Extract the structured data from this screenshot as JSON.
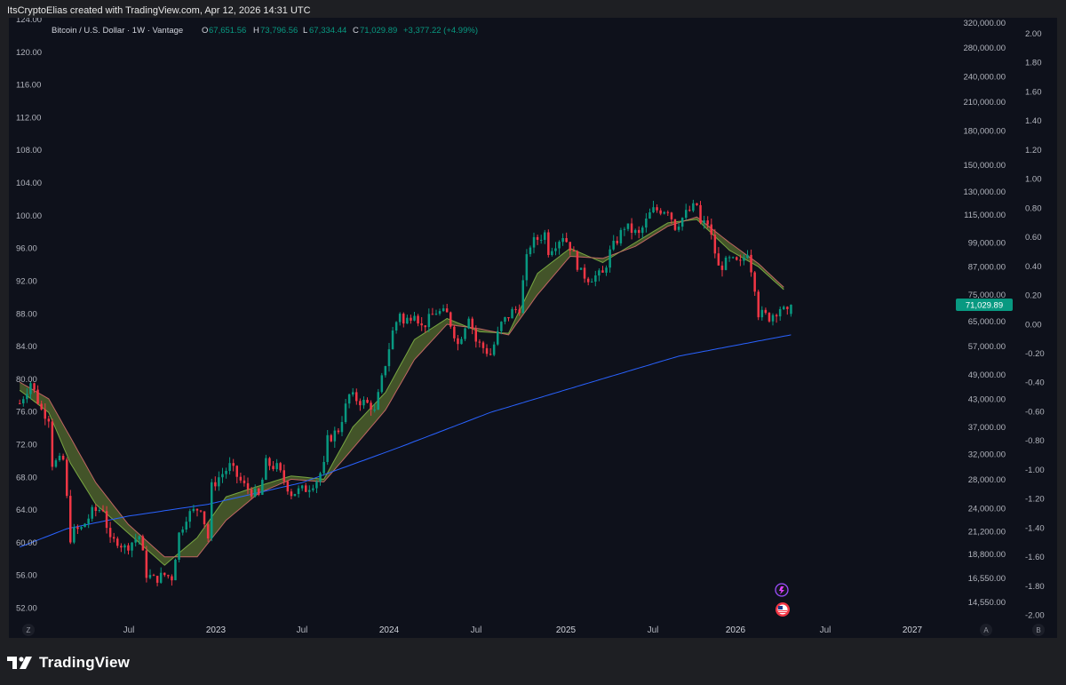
{
  "header": {
    "text": "ItsCryptoElias created with TradingView.com, Apr 12, 2026 14:31 UTC"
  },
  "legend": {
    "symbol": "Bitcoin / U.S. Dollar · 1W · Vantage",
    "o_label": "O",
    "o_value": "67,651.56",
    "h_label": "H",
    "h_value": "73,796.56",
    "l_label": "L",
    "l_value": "67,334.44",
    "c_label": "C",
    "c_value": "71,029.89",
    "change": "+3,377.22 (+4.99%)"
  },
  "footer": {
    "brand": "TradingView"
  },
  "colors": {
    "background": "#0e111b",
    "frame": "#1e1f23",
    "up": "#089981",
    "down": "#f23645",
    "ribbon_fill": "#556b2f",
    "ma_blue": "#2962ff",
    "price_label_bg": "#089981",
    "axis_text": "#b2b5be"
  },
  "chart_data": {
    "type": "candlestick",
    "current_price_label": "71,029.89",
    "current_price": 71029.89,
    "x_axis": {
      "labels": [
        "Jul",
        "2023",
        "Jul",
        "2024",
        "Jul",
        "2025",
        "Jul",
        "2026",
        "Jul",
        "2027"
      ],
      "range": [
        "2022-03-01",
        "2027-03-01"
      ]
    },
    "left_axis": {
      "labels": [
        "124.00",
        "120.00",
        "116.00",
        "112.00",
        "108.00",
        "104.00",
        "100.00",
        "96.00",
        "92.00",
        "88.00",
        "84.00",
        "80.00",
        "76.00",
        "72.00",
        "68.00",
        "64.00",
        "60.00",
        "56.00",
        "52.00"
      ],
      "range": [
        52,
        124
      ]
    },
    "price_axis": {
      "scale": "log",
      "labels": [
        "320,000.00",
        "280,000.00",
        "240,000.00",
        "210,000.00",
        "180,000.00",
        "150,000.00",
        "130,000.00",
        "115,000.00",
        "99,000.00",
        "87,000.00",
        "75,000.00",
        "65,000.00",
        "57,000.00",
        "49,000.00",
        "43,000.00",
        "37,000.00",
        "32,000.00",
        "28,000.00",
        "24,000.00",
        "21,200.00",
        "18,800.00",
        "16,550.00",
        "14,550.00"
      ]
    },
    "right_axis": {
      "labels": [
        "2.00",
        "1.80",
        "1.60",
        "1.40",
        "1.20",
        "1.00",
        "0.80",
        "0.60",
        "0.40",
        "0.20",
        "0.00",
        "-0.20",
        "-0.40",
        "-0.60",
        "-0.80",
        "-1.00",
        "-1.20",
        "-1.40",
        "-1.60",
        "-1.80",
        "-2.00"
      ],
      "range": [
        -2,
        2
      ]
    },
    "axis_corner_labels": [
      "Z",
      "A",
      "B"
    ],
    "price_path": [
      [
        "2022-03-07",
        42000
      ],
      [
        "2022-03-28",
        47000
      ],
      [
        "2022-04-18",
        40500
      ],
      [
        "2022-05-02",
        39000
      ],
      [
        "2022-05-09",
        30500
      ],
      [
        "2022-05-30",
        31000
      ],
      [
        "2022-06-13",
        20500
      ],
      [
        "2022-06-20",
        21200
      ],
      [
        "2022-07-04",
        21500
      ],
      [
        "2022-07-25",
        23500
      ],
      [
        "2022-08-15",
        24000
      ],
      [
        "2022-08-29",
        20000
      ],
      [
        "2022-09-12",
        20200
      ],
      [
        "2022-09-26",
        19400
      ],
      [
        "2022-10-24",
        20700
      ],
      [
        "2022-11-07",
        16900
      ],
      [
        "2022-11-21",
        16400
      ],
      [
        "2022-12-12",
        16800
      ],
      [
        "2022-12-26",
        16600
      ],
      [
        "2023-01-09",
        20900
      ],
      [
        "2023-01-23",
        23000
      ],
      [
        "2023-02-20",
        24200
      ],
      [
        "2023-03-06",
        20500
      ],
      [
        "2023-03-13",
        26900
      ],
      [
        "2023-03-27",
        28300
      ],
      [
        "2023-04-17",
        30000
      ],
      [
        "2023-05-15",
        27000
      ],
      [
        "2023-06-12",
        25500
      ],
      [
        "2023-06-26",
        30500
      ],
      [
        "2023-07-17",
        29800
      ],
      [
        "2023-08-14",
        26000
      ],
      [
        "2023-09-11",
        26600
      ],
      [
        "2023-10-02",
        27900
      ],
      [
        "2023-10-16",
        30000
      ],
      [
        "2023-10-23",
        34500
      ],
      [
        "2023-11-13",
        36500
      ],
      [
        "2023-12-04",
        43800
      ],
      [
        "2023-12-25",
        42500
      ],
      [
        "2024-01-15",
        41500
      ],
      [
        "2024-01-22",
        40000
      ],
      [
        "2024-02-12",
        52000
      ],
      [
        "2024-02-26",
        61500
      ],
      [
        "2024-03-11",
        68500
      ],
      [
        "2024-03-18",
        64000
      ],
      [
        "2024-04-08",
        69000
      ],
      [
        "2024-04-22",
        63000
      ],
      [
        "2024-05-20",
        68500
      ],
      [
        "2024-06-10",
        67500
      ],
      [
        "2024-06-24",
        61000
      ],
      [
        "2024-07-01",
        57500
      ],
      [
        "2024-07-22",
        67500
      ],
      [
        "2024-08-05",
        58500
      ],
      [
        "2024-09-02",
        54500
      ],
      [
        "2024-09-23",
        64000
      ],
      [
        "2024-10-14",
        68500
      ],
      [
        "2024-10-28",
        70000
      ],
      [
        "2024-11-04",
        80000
      ],
      [
        "2024-11-11",
        90500
      ],
      [
        "2024-11-18",
        98000
      ],
      [
        "2024-12-16",
        104000
      ],
      [
        "2024-12-23",
        95000
      ],
      [
        "2025-01-20",
        103000
      ],
      [
        "2025-02-03",
        97000
      ],
      [
        "2025-02-24",
        84000
      ],
      [
        "2025-03-10",
        82000
      ],
      [
        "2025-04-07",
        83500
      ],
      [
        "2025-04-21",
        94000
      ],
      [
        "2025-05-12",
        104000
      ],
      [
        "2025-05-19",
        108000
      ],
      [
        "2025-06-16",
        103000
      ],
      [
        "2025-07-07",
        115000
      ],
      [
        "2025-07-14",
        117500
      ],
      [
        "2025-08-11",
        118500
      ],
      [
        "2025-08-25",
        108000
      ],
      [
        "2025-09-15",
        115500
      ],
      [
        "2025-10-06",
        121000
      ],
      [
        "2025-10-13",
        109000
      ],
      [
        "2025-10-27",
        110000
      ],
      [
        "2025-11-10",
        94000
      ],
      [
        "2025-11-17",
        86500
      ],
      [
        "2025-12-08",
        90000
      ],
      [
        "2025-12-29",
        88000
      ],
      [
        "2026-01-12",
        95000
      ],
      [
        "2026-01-26",
        78500
      ],
      [
        "2026-02-02",
        68000
      ],
      [
        "2026-02-23",
        66500
      ],
      [
        "2026-03-16",
        70000
      ],
      [
        "2026-03-30",
        67500
      ],
      [
        "2026-04-06",
        71029.89
      ]
    ],
    "series": [
      {
        "kind": "ribbon-fast",
        "points": [
          [
            "2022-03-07",
            45000
          ],
          [
            "2022-05-02",
            40000
          ],
          [
            "2022-06-13",
            30500
          ],
          [
            "2022-08-01",
            24500
          ],
          [
            "2022-10-03",
            21000
          ],
          [
            "2022-12-12",
            17700
          ],
          [
            "2023-02-13",
            20500
          ],
          [
            "2023-04-10",
            25500
          ],
          [
            "2023-06-12",
            27000
          ],
          [
            "2023-08-14",
            28500
          ],
          [
            "2023-10-16",
            28000
          ],
          [
            "2023-12-11",
            37000
          ],
          [
            "2024-02-12",
            44500
          ],
          [
            "2024-04-08",
            59000
          ],
          [
            "2024-06-10",
            66000
          ],
          [
            "2024-08-12",
            61500
          ],
          [
            "2024-10-07",
            61000
          ],
          [
            "2024-12-02",
            84000
          ],
          [
            "2025-02-03",
            96000
          ],
          [
            "2025-04-07",
            89000
          ],
          [
            "2025-06-09",
            99000
          ],
          [
            "2025-08-11",
            110000
          ],
          [
            "2025-10-06",
            112000
          ],
          [
            "2025-12-08",
            95000
          ],
          [
            "2026-02-02",
            87000
          ],
          [
            "2026-03-23",
            77000
          ]
        ]
      },
      {
        "kind": "ribbon-slow",
        "points": [
          [
            "2022-03-07",
            47000
          ],
          [
            "2022-05-02",
            43000
          ],
          [
            "2022-06-13",
            35000
          ],
          [
            "2022-08-01",
            27500
          ],
          [
            "2022-10-03",
            22000
          ],
          [
            "2022-12-12",
            18500
          ],
          [
            "2023-02-13",
            18500
          ],
          [
            "2023-04-10",
            22500
          ],
          [
            "2023-06-12",
            26000
          ],
          [
            "2023-08-14",
            28000
          ],
          [
            "2023-10-16",
            27600
          ],
          [
            "2023-12-11",
            33000
          ],
          [
            "2024-02-12",
            40500
          ],
          [
            "2024-04-08",
            53000
          ],
          [
            "2024-06-10",
            64000
          ],
          [
            "2024-08-12",
            62500
          ],
          [
            "2024-10-07",
            60500
          ],
          [
            "2024-12-02",
            75000
          ],
          [
            "2025-02-03",
            92000
          ],
          [
            "2025-04-07",
            91000
          ],
          [
            "2025-06-09",
            97000
          ],
          [
            "2025-08-11",
            108000
          ],
          [
            "2025-10-06",
            113500
          ],
          [
            "2025-12-08",
            99000
          ],
          [
            "2026-02-02",
            88500
          ],
          [
            "2026-03-23",
            78000
          ]
        ]
      },
      {
        "kind": "long-ma",
        "points": [
          [
            "2022-03-07",
            19500
          ],
          [
            "2022-06-06",
            21500
          ],
          [
            "2022-10-03",
            23000
          ],
          [
            "2023-03-06",
            24500
          ],
          [
            "2023-09-04",
            27500
          ],
          [
            "2024-03-04",
            33000
          ],
          [
            "2024-09-02",
            40000
          ],
          [
            "2025-03-03",
            46500
          ],
          [
            "2025-09-01",
            54000
          ],
          [
            "2026-04-06",
            60500
          ]
        ]
      }
    ]
  }
}
